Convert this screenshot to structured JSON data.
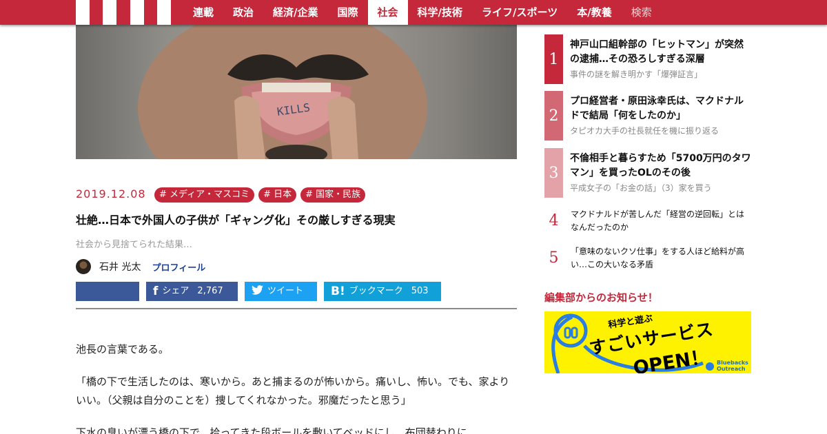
{
  "nav": {
    "items": [
      {
        "label": "連載",
        "active": false
      },
      {
        "label": "政治",
        "active": false
      },
      {
        "label": "経済/企業",
        "active": false
      },
      {
        "label": "国際",
        "active": false
      },
      {
        "label": "社会",
        "active": true
      },
      {
        "label": "科学/技術",
        "active": false
      },
      {
        "label": "ライフ/スポーツ",
        "active": false
      },
      {
        "label": "本/教養",
        "active": false
      }
    ],
    "search_label": "検索"
  },
  "hero": {
    "tattoo_text": "KILLS"
  },
  "article": {
    "date": "2019.12.08",
    "tags": [
      "# メディア・マスコミ",
      "# 日本",
      "# 国家・民族"
    ],
    "headline": "壮絶…日本で外国人の子供が「ギャング化」その厳しすぎる現実",
    "subhead": "社会から見捨てられた結果…",
    "author": "石井 光太",
    "profile_link": "プロフィール",
    "share": {
      "facebook_label": "シェア",
      "facebook_count": "2,767",
      "twitter_label": "ツイート",
      "hatena_label": "ブックマーク",
      "hatena_count": "503"
    },
    "paragraphs": [
      "池長の言葉である。",
      "「橋の下で生活したのは、寒いから。あと捕まるのが怖いから。痛いし、怖い。でも、家よりいい。（父親は自分のことを）捜してくれなかった。邪魔だったと思う」",
      "下水の臭いが漂う橋の下で、拾ってきた段ボールを敷いてベッドにし、布団替わりに"
    ]
  },
  "ranking": [
    {
      "num": "1",
      "title": "神戸山口組幹部の「ヒットマン」が突然の逮捕…その恐ろしすぎる深層",
      "sub": "事件の謎を解き明かす「爆弾証言」",
      "color": "#c4283a"
    },
    {
      "num": "2",
      "title": "プロ経営者・原田泳幸氏は、マクドナルドで結局「何をしたのか」",
      "sub": "タピオカ大手の社長就任を機に振り返る",
      "color": "#d26874"
    },
    {
      "num": "3",
      "title": "不倫相手と暮らすため「5700万円のタワマン」を買ったOLのその後",
      "sub": "平成女子の「お金の話」（3）家を買う",
      "color": "#e3a1a8"
    },
    {
      "num": "4",
      "title": "マクドナルドが苦しんだ「経営の逆回転」とはなんだったのか"
    },
    {
      "num": "5",
      "title": "「意味のないクソ仕事」をする人ほど給料が高い…この大いなる矛盾"
    }
  ],
  "notice": {
    "title": "編集部からのお知らせ！",
    "banner_small": "科学と遊ぶ",
    "banner_big": "すごいサービス",
    "banner_open": "OPEN！",
    "banner_logo_line1": "Bluebacks",
    "banner_logo_line2": "Outreach"
  }
}
